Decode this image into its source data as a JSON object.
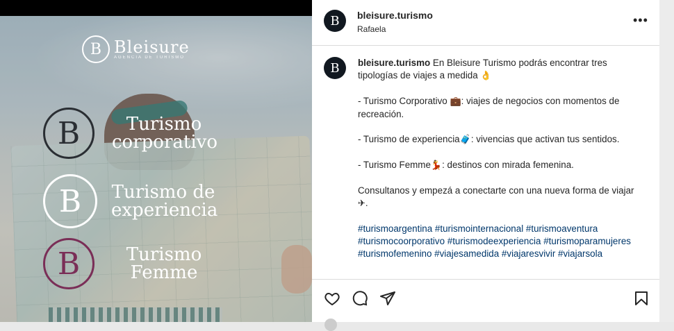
{
  "post_image": {
    "brand": {
      "mark": "B",
      "name": "Bleisure",
      "subtitle": "AGENCIA DE TURISMO"
    },
    "services": [
      {
        "mark": "B",
        "line1": "Turismo",
        "line2": "corporativo",
        "color": "#2a2e33"
      },
      {
        "mark": "B",
        "line1": "Turismo de",
        "line2": "experiencia",
        "color": "#ffffff"
      },
      {
        "mark": "B",
        "line1": "Turismo",
        "line2": "Femme",
        "color": "#7a2e57"
      }
    ]
  },
  "header": {
    "avatar_mark": "B",
    "username": "bleisure.turismo",
    "location": "Rafaela",
    "more_icon": "•••"
  },
  "caption": {
    "avatar_mark": "B",
    "username": "bleisure.turismo",
    "intro": " En Bleisure Turismo podrás encontrar tres tipologías de viajes a medida ",
    "intro_emoji": "👌",
    "item1_a": "- Turismo Corporativo ",
    "item1_emoji": "💼",
    "item1_b": ": viajes de negocios con momentos de recreación.",
    "item2_a": "- Turismo de experiencia",
    "item2_emoji": "🧳",
    "item2_b": ": vivencias que activan tus sentidos.",
    "item3_a": "- Turismo Femme",
    "item3_emoji": "💃",
    "item3_b": ": destinos con mirada femenina.",
    "closing_a": "Consultanos y empezá a conectarte con una nueva forma de viajar ",
    "closing_emoji": "✈",
    "closing_b": ".",
    "hashtags": "#turismoargentina #turismointernacional #turismoaventura #turismocoorporativo #turismodeexperiencia #turismoparamujeres #turismofemenino #viajesamedida #viajaresvivir #viajarsola"
  },
  "actions": {
    "like_icon": "heart-icon",
    "comment_icon": "comment-icon",
    "share_icon": "paper-plane-icon",
    "save_icon": "bookmark-icon"
  },
  "colors": {
    "link": "#00376b",
    "text": "#262626",
    "divider": "#dbdbdb",
    "avatar_bg": "#111820"
  }
}
